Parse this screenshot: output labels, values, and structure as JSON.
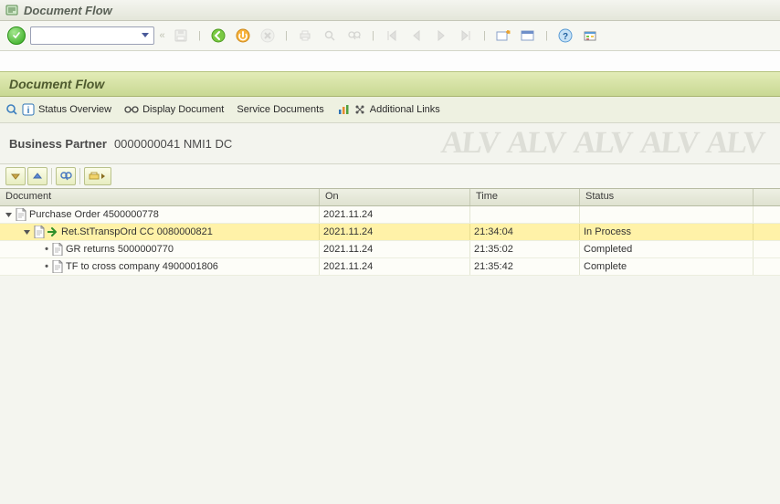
{
  "window": {
    "title": "Document Flow"
  },
  "section": {
    "title": "Document Flow"
  },
  "app_toolbar": {
    "status_overview": "Status Overview",
    "display_document": "Display Document",
    "service_documents": "Service Documents",
    "additional_links": "Additional Links"
  },
  "bp": {
    "label": "Business Partner",
    "value": "0000000041 NMI1 DC"
  },
  "grid": {
    "headers": {
      "document": "Document",
      "on": "On",
      "time": "Time",
      "status": "Status"
    },
    "rows": [
      {
        "indent": 0,
        "expandable": true,
        "expanded": true,
        "icon": "document-icon",
        "text": "Purchase Order 4500000778",
        "on": "2021.11.24",
        "time": "",
        "status": "",
        "selected": false
      },
      {
        "indent": 1,
        "expandable": true,
        "expanded": true,
        "icon": "document-arrow-icon",
        "text": "Ret.StTranspOrd CC 0080000821",
        "on": "2021.11.24",
        "time": "21:34:04",
        "status": "In Process",
        "selected": true
      },
      {
        "indent": 2,
        "expandable": false,
        "icon": "document-icon",
        "text": "GR returns 5000000770",
        "on": "2021.11.24",
        "time": "21:35:02",
        "status": "Completed",
        "selected": false
      },
      {
        "indent": 2,
        "expandable": false,
        "icon": "document-icon",
        "text": "TF to cross company 4900001806",
        "on": "2021.11.24",
        "time": "21:35:42",
        "status": "Complete",
        "selected": false
      }
    ]
  }
}
